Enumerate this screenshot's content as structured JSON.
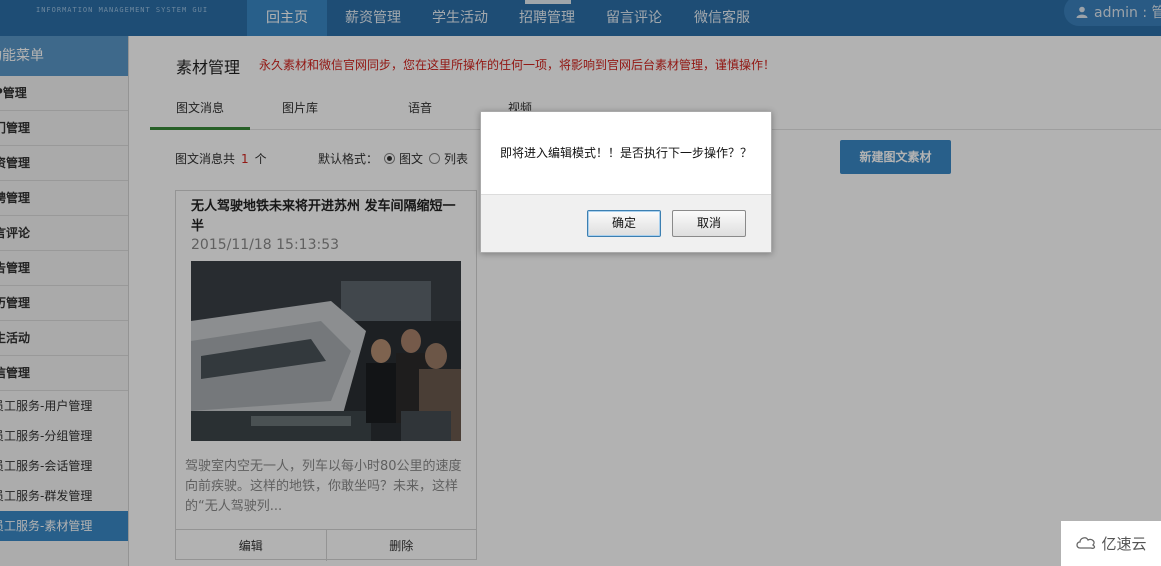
{
  "header": {
    "logo_subtitle": "INFORMATION MANAGEMENT SYSTEM GUI",
    "nav": [
      {
        "label": "回主页",
        "active": true
      },
      {
        "label": "薪资管理",
        "active": false
      },
      {
        "label": "学生活动",
        "active": false
      },
      {
        "label": "招聘管理",
        "active": false
      },
      {
        "label": "留言评论",
        "active": false
      },
      {
        "label": "微信客服",
        "active": false
      }
    ],
    "user_label": "admin : 管"
  },
  "sidebar": {
    "header": "功能菜单",
    "items": [
      {
        "label": "P管理"
      },
      {
        "label": "门管理"
      },
      {
        "label": "资管理"
      },
      {
        "label": "聘管理"
      },
      {
        "label": "言评论"
      },
      {
        "label": "告管理"
      },
      {
        "label": "历管理"
      },
      {
        "label": "生活动"
      },
      {
        "label": "信管理"
      }
    ],
    "subitems": [
      {
        "label": "员工服务-用户管理",
        "active": false
      },
      {
        "label": "员工服务-分组管理",
        "active": false
      },
      {
        "label": "员工服务-会话管理",
        "active": false
      },
      {
        "label": "员工服务-群发管理",
        "active": false
      },
      {
        "label": "员工服务-素材管理",
        "active": true
      }
    ]
  },
  "main": {
    "title": "素材管理",
    "warning": "永久素材和微信官网同步，您在这里所操作的任何一项，将影响到官网后台素材管理，谨慎操作！",
    "tabs": [
      {
        "label": "图文消息",
        "active": true
      },
      {
        "label": "图片库",
        "active": false
      },
      {
        "label": "语音",
        "active": false
      },
      {
        "label": "视频",
        "active": false
      }
    ],
    "count_prefix": "图文消息共",
    "count_value": "1",
    "count_suffix": "个",
    "format_label": "默认格式：",
    "format_option_1": "图文",
    "format_option_2": "列表",
    "new_button": "新建图文素材"
  },
  "card": {
    "title": "无人驾驶地铁未来将开进苏州 发车间隔缩短一半",
    "date": "2015/11/18 15:13:53",
    "image_alt": "train exhibition photo",
    "summary": "驾驶室内空无一人，列车以每小时80公里的速度向前疾驶。这样的地铁，你敢坐吗？未来，这样的“无人驾驶列...",
    "edit_label": "编辑",
    "delete_label": "删除"
  },
  "dialog": {
    "message": "即将进入编辑模式！！是否执行下一步操作？？",
    "ok_label": "确定",
    "cancel_label": "取消"
  },
  "watermark": {
    "text": "亿速云"
  },
  "colors": {
    "header_bg": "#2b6fa8",
    "accent_blue": "#3a89c6",
    "warning_red": "#d2231d",
    "tab_underline_green": "#3a8a3a"
  }
}
